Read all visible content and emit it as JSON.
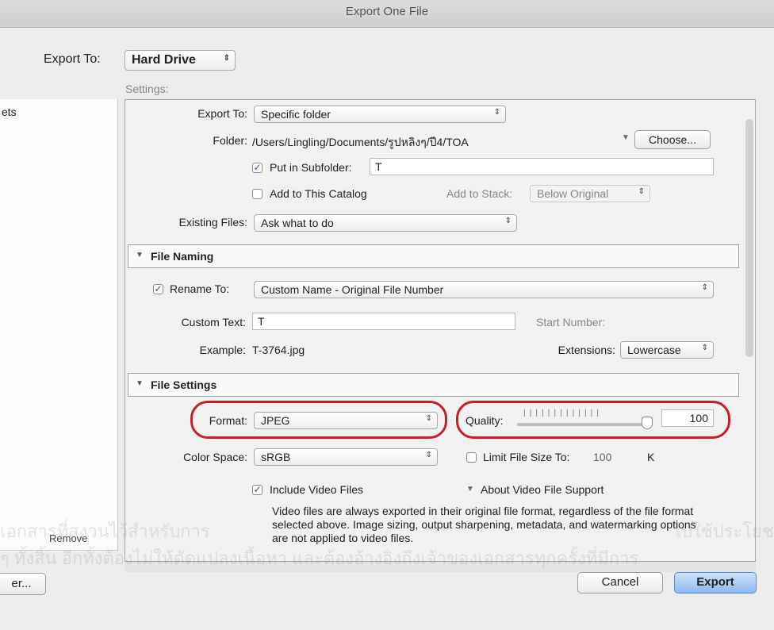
{
  "window": {
    "title": "Export One File"
  },
  "header": {
    "export_to_label": "Export To:",
    "export_to_value": "Hard Drive"
  },
  "settings": {
    "label": "Settings:"
  },
  "sidebar": {
    "partial_item": "ets",
    "remove_label": "Remove"
  },
  "location": {
    "export_to_label": "Export To:",
    "export_to_value": "Specific folder",
    "folder_label": "Folder:",
    "folder_path": "/Users/Lingling/Documents/รูปหลิงๆ/ปี4/TOA",
    "choose_label": "Choose...",
    "subfolder_checked": true,
    "subfolder_label": "Put in Subfolder:",
    "subfolder_value": "T",
    "add_catalog_checked": false,
    "add_catalog_label": "Add to This Catalog",
    "add_stack_label": "Add to Stack:",
    "add_stack_value": "Below Original",
    "existing_files_label": "Existing Files:",
    "existing_files_value": "Ask what to do"
  },
  "file_naming": {
    "title": "File Naming",
    "rename_checked": true,
    "rename_label": "Rename To:",
    "rename_value": "Custom Name - Original File Number",
    "custom_text_label": "Custom Text:",
    "custom_text_value": "T",
    "start_number_label": "Start Number:",
    "example_label": "Example:",
    "example_value": "T-3764.jpg",
    "extensions_label": "Extensions:",
    "extensions_value": "Lowercase"
  },
  "file_settings": {
    "title": "File Settings",
    "format_label": "Format:",
    "format_value": "JPEG",
    "quality_label": "Quality:",
    "quality_value": "100",
    "quality_level": 1.0,
    "color_space_label": "Color Space:",
    "color_space_value": "sRGB",
    "limit_checked": false,
    "limit_label": "Limit File Size To:",
    "limit_value": "100",
    "limit_unit": "K",
    "video_checked": true,
    "video_label": "Include Video Files",
    "about_video_label": "About Video File Support",
    "video_info": "Video files are always exported in their original file format, regardless of the file format selected above. Image sizing, output sharpening, metadata, and watermarking options are not applied to video files."
  },
  "footer": {
    "left_button": "er...",
    "cancel_label": "Cancel",
    "export_label": "Export"
  },
  "watermark": {
    "line1": "เอกสารที่สงวนไว้สำหรับการ",
    "line1b": "ไปใช้ประโยชน์",
    "line2": "ๆ ทั้งสิ้น อีกทั้งต้องไม่ให้ดัดแปลงเนื้อหา และต้องอ้างอิงถึงเจ้าของเอกสารทุกครั้งที่มีการ"
  },
  "accent": {
    "highlight_oval": "#c81e2b"
  }
}
